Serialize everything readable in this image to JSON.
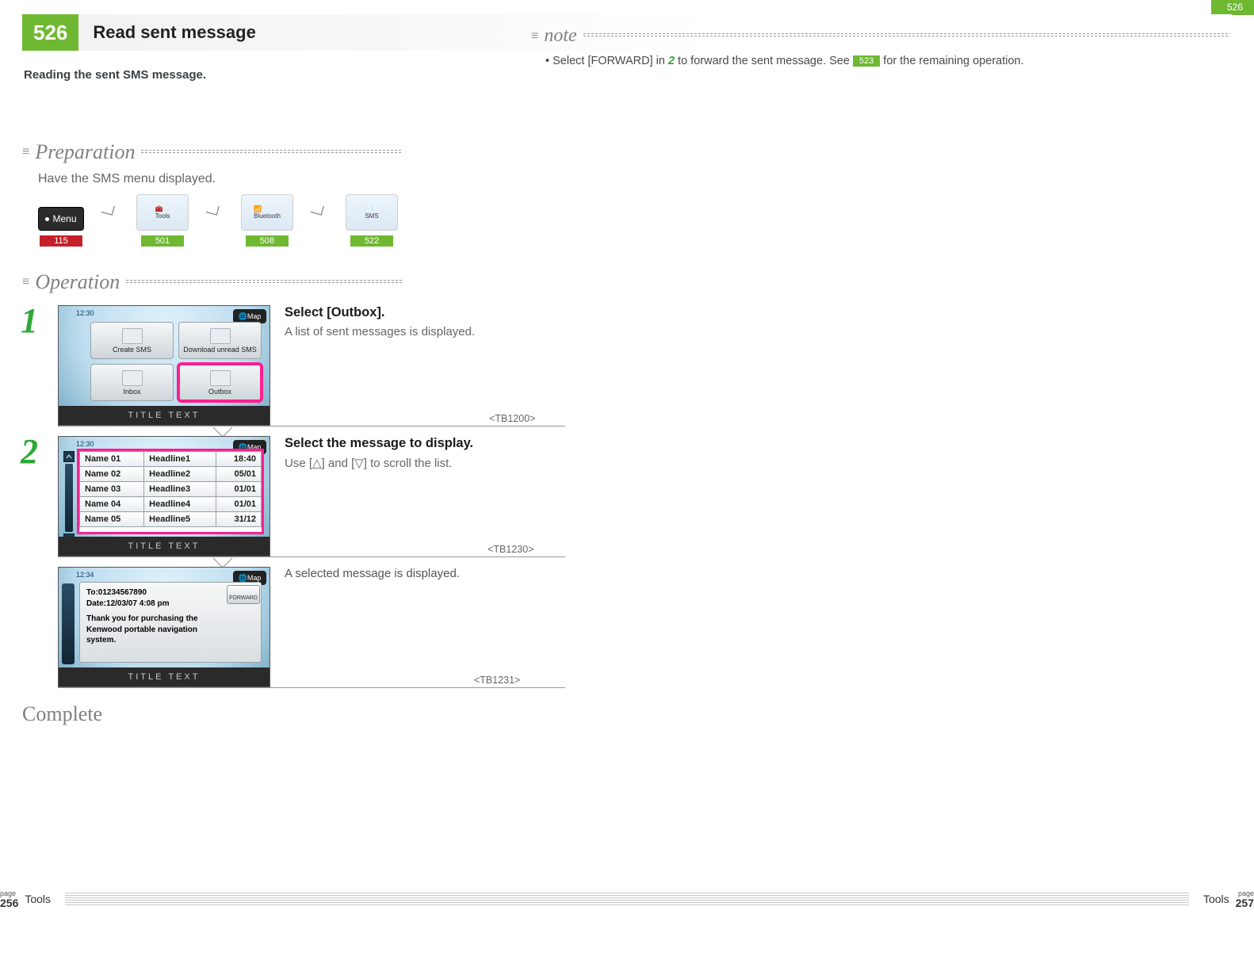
{
  "corner_tab": "526",
  "header": {
    "badge": "526",
    "title": "Read sent message"
  },
  "subtitle": "Reading the sent SMS message.",
  "note": {
    "label": "note",
    "text_before": "Select [FORWARD] in ",
    "step_ref": "2",
    "text_mid": " to forward the sent message. See ",
    "ref": "523",
    "text_after": " for the remaining operation."
  },
  "prep": {
    "label": "Preparation",
    "body": "Have the SMS menu displayed.",
    "flow": [
      {
        "label": "Menu",
        "ref": "115",
        "ref_style": "red"
      },
      {
        "label": "Tools",
        "ref": "501",
        "ref_style": "green"
      },
      {
        "label": "Bluetooth",
        "ref": "508",
        "ref_style": "green"
      },
      {
        "label": "SMS",
        "ref": "522",
        "ref_style": "green"
      }
    ]
  },
  "operation": {
    "label": "Operation",
    "steps": [
      {
        "num": "1",
        "lead": "Select [Outbox].",
        "sub": "A list of sent messages is displayed.",
        "tbref": "<TB1200>",
        "screen": {
          "time": "12:30",
          "map": "Map",
          "title": "TITLE TEXT",
          "tiles": [
            "Create SMS",
            "Download unread SMS",
            "Inbox",
            "Outbox"
          ],
          "highlight_index": 3
        }
      },
      {
        "num": "2",
        "lead": "Select the message to display.",
        "sub": "Use [△] and [▽] to scroll the list.",
        "tbref": "<TB1230>",
        "screen": {
          "time": "12:30",
          "map": "Map",
          "title": "TITLE TEXT",
          "rows": [
            [
              "Name 01",
              "Headline1",
              "18:40"
            ],
            [
              "Name 02",
              "Headline2",
              "05/01"
            ],
            [
              "Name 03",
              "Headline3",
              "01/01"
            ],
            [
              "Name 04",
              "Headline4",
              "01/01"
            ],
            [
              "Name 05",
              "Headline5",
              "31/12"
            ]
          ]
        }
      },
      {
        "lead": "A selected message is displayed.",
        "tbref": "<TB1231>",
        "screen": {
          "time": "12:34",
          "map": "Map",
          "title": "TITLE TEXT",
          "to": "To:01234567890",
          "date": "Date:12/03/07 4:08 pm",
          "body": "Thank you for purchasing the Kenwood portable navigation system.",
          "forward": "FORWARD"
        }
      }
    ]
  },
  "complete": "Complete",
  "footer": {
    "left_page_label": "page",
    "left_page_num": "256",
    "right_page_label": "page",
    "right_page_num": "257",
    "section": "Tools"
  }
}
